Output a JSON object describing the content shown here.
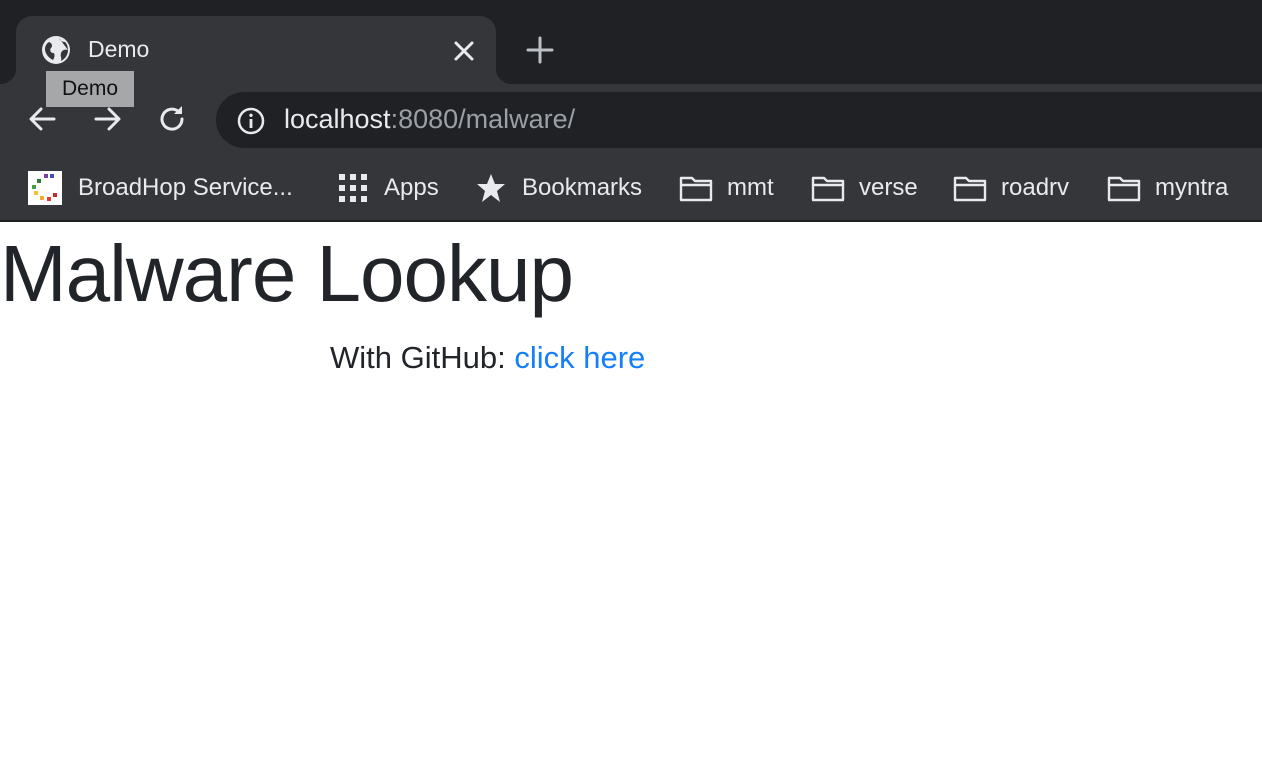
{
  "browser": {
    "tab": {
      "title": "Demo",
      "favicon": "globe-icon"
    },
    "tooltip": "Demo",
    "nav": {
      "back": "arrow-left-icon",
      "forward": "arrow-right-icon",
      "reload": "reload-icon"
    },
    "address_bar": {
      "host": "localhost",
      "rest": ":8080/malware/",
      "icon": "info-icon"
    },
    "bookmarks": [
      {
        "label": "BroadHop Service...",
        "icon": "site-favicon"
      },
      {
        "label": "Apps",
        "icon": "apps-grid-icon"
      },
      {
        "label": "Bookmarks",
        "icon": "star-icon"
      },
      {
        "label": "mmt",
        "icon": "folder-icon"
      },
      {
        "label": "verse",
        "icon": "folder-icon"
      },
      {
        "label": "roadrv",
        "icon": "folder-icon"
      },
      {
        "label": "myntra",
        "icon": "folder-icon"
      }
    ],
    "colors": {
      "tabstrip": "#202124",
      "toolbar": "#35363a",
      "omnibox": "#202124",
      "text": "#e8eaed",
      "url_dim": "#9aa0a6"
    }
  },
  "page": {
    "heading": "Malware Lookup",
    "github_prefix": "With GitHub: ",
    "github_link": "click here",
    "colors": {
      "text": "#212529",
      "link": "#157efb"
    }
  }
}
